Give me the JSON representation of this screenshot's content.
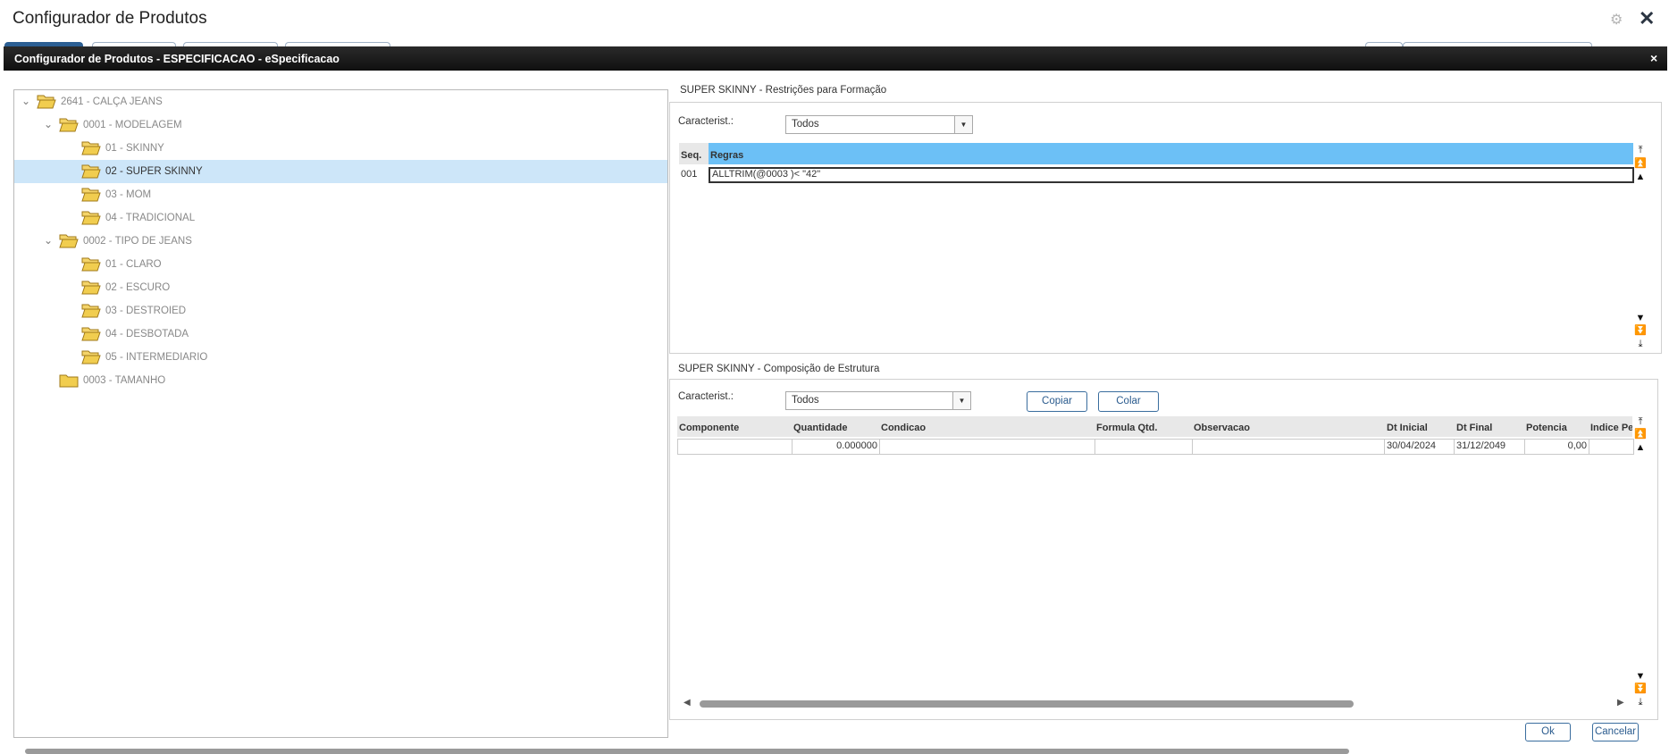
{
  "outer": {
    "title": "Configurador de Produtos",
    "gear_icon": "gear-icon",
    "close_icon": "close-icon"
  },
  "dialog": {
    "title": "Configurador de Produtos - ESPECIFICACAO - eSpecificacao",
    "close_glyph": "×"
  },
  "tree": {
    "items": [
      {
        "label": "2641 - CALÇA JEANS",
        "level": 0,
        "expanded": true
      },
      {
        "label": "0001 - MODELAGEM",
        "level": 1,
        "expanded": true
      },
      {
        "label": "01 - SKINNY",
        "level": 2
      },
      {
        "label": "02 - SUPER SKINNY",
        "level": 2,
        "selected": true
      },
      {
        "label": "03 - MOM",
        "level": 2
      },
      {
        "label": "04 - TRADICIONAL",
        "level": 2
      },
      {
        "label": "0002 - TIPO DE JEANS",
        "level": 1,
        "expanded": true
      },
      {
        "label": "01 - CLARO",
        "level": 2
      },
      {
        "label": "02 - ESCURO",
        "level": 2
      },
      {
        "label": "03 - DESTROIED",
        "level": 2
      },
      {
        "label": "04 - DESBOTADA",
        "level": 2
      },
      {
        "label": "05 - INTERMEDIARIO",
        "level": 2
      },
      {
        "label": "0003 - TAMANHO",
        "level": 1,
        "expanded": false
      }
    ]
  },
  "restrictions": {
    "title": "SUPER SKINNY - Restrições para Formação",
    "filter_label": "Caracterist.:",
    "filter_value": "Todos",
    "columns": [
      "Seq.",
      "Regras"
    ],
    "rows": [
      {
        "seq": "001",
        "rule": "ALLTRIM(@0003 )< \"42\""
      }
    ]
  },
  "structure": {
    "title": "SUPER SKINNY - Composição de Estrutura",
    "filter_label": "Caracterist.:",
    "filter_value": "Todos",
    "copy_label": "Copiar",
    "paste_label": "Colar",
    "columns": [
      "Componente",
      "Quantidade",
      "Condicao",
      "Formula Qtd.",
      "Observacao",
      "Dt Inicial",
      "Dt Final",
      "Potencia",
      "Indice Pe"
    ],
    "row": {
      "componente": "",
      "quantidade": "0.000000",
      "condicao": "",
      "formula": "",
      "observacao": "",
      "dt_inicial": "30/04/2024",
      "dt_final": "31/12/2049",
      "potencia": "0,00",
      "indice": ""
    }
  },
  "footer": {
    "ok_label": "Ok",
    "cancel_label": "Cancelar"
  },
  "colors": {
    "selected_row": "#cde6f9",
    "grid_header_selected": "#6cc0f6",
    "dialog_bar": "#1a1a1a",
    "folder": "#f1cd4f"
  }
}
